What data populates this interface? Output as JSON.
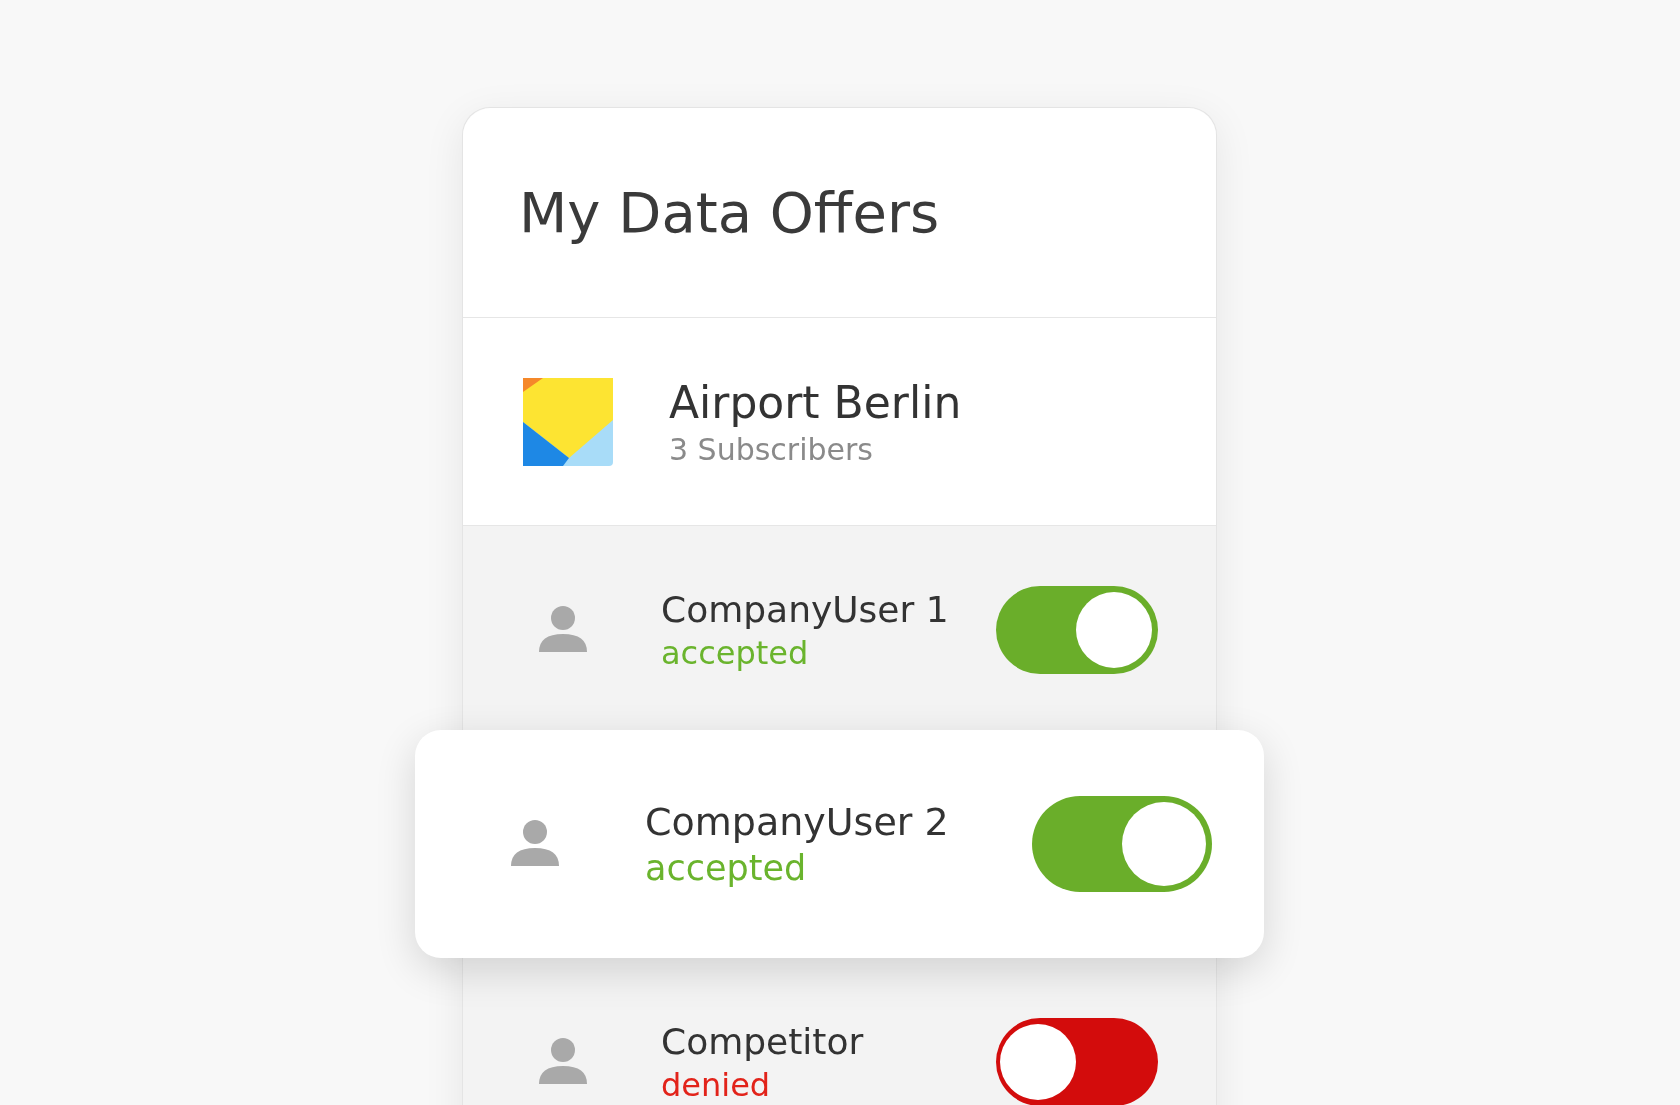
{
  "card": {
    "title": "My Data Offers"
  },
  "offer": {
    "name": "Airport Berlin",
    "subscribers": "3 Subscribers"
  },
  "subscribers": [
    {
      "name": "CompanyUser 1",
      "status": "accepted",
      "kind": "accepted",
      "on": true,
      "raised": false
    },
    {
      "name": "CompanyUser 2",
      "status": "accepted",
      "kind": "accepted",
      "on": true,
      "raised": true
    },
    {
      "name": "Competitor",
      "status": "denied",
      "kind": "denied",
      "on": false,
      "raised": false
    }
  ]
}
